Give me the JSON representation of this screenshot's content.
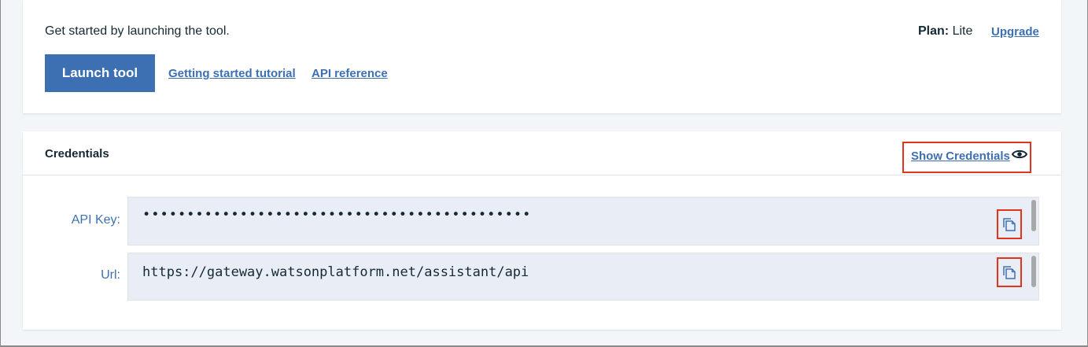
{
  "launch": {
    "intro_text": "Get started by launching the tool.",
    "plan_label": "Plan:",
    "plan_value": "Lite",
    "upgrade_label": "Upgrade",
    "launch_button_label": "Launch tool",
    "tutorial_link_label": "Getting started tutorial",
    "api_reference_link_label": "API reference"
  },
  "credentials": {
    "title": "Credentials",
    "show_label": "Show Credentials",
    "show_icon": "eye-icon",
    "fields": [
      {
        "label": "API Key:",
        "value": "••••••••••••••••••••••••••••••••••••••••••••",
        "copy_icon": "copy-icon"
      },
      {
        "label": "Url:",
        "value": "https://gateway.watsonplatform.net/assistant/api",
        "copy_icon": "copy-icon"
      }
    ]
  },
  "colors": {
    "accent": "#3d70b2",
    "highlight_border": "#e0351c",
    "field_background": "#e9eef6",
    "page_background": "#f3f6f9"
  }
}
